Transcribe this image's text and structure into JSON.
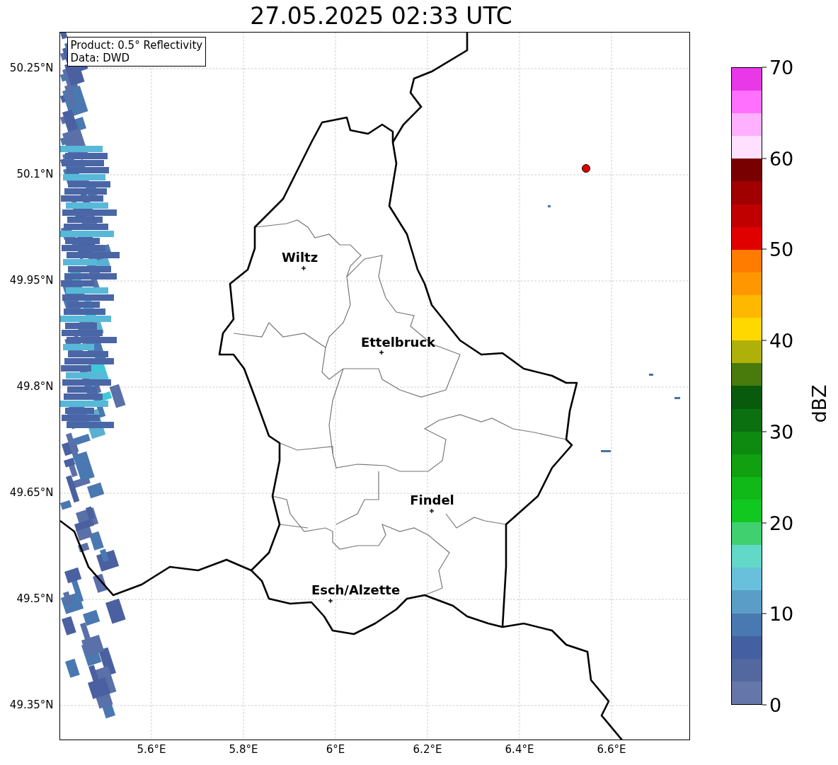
{
  "title": "27.05.2025 02:33 UTC",
  "info_box": [
    "Product: 0.5° Reflectivity",
    "Data: DWD"
  ],
  "y_ticks": [
    "50.25°N",
    "50.1°N",
    "49.95°N",
    "49.8°N",
    "49.65°N",
    "49.5°N",
    "49.35°N"
  ],
  "x_ticks": [
    "5.6°E",
    "5.8°E",
    "6°E",
    "6.2°E",
    "6.4°E",
    "6.6°E"
  ],
  "cities": [
    {
      "name": "Wiltz"
    },
    {
      "name": "Ettelbruck"
    },
    {
      "name": "Findel"
    },
    {
      "name": "Esch/Alzette"
    }
  ],
  "colorbar": {
    "label": "dBZ",
    "ticks": [
      "70",
      "60",
      "50",
      "40",
      "30",
      "20",
      "10",
      "0"
    ],
    "bins": [
      {
        "color": "#6577a8"
      },
      {
        "color": "#5468a0"
      },
      {
        "color": "#4560a0"
      },
      {
        "color": "#4a78b0"
      },
      {
        "color": "#5a9ec8"
      },
      {
        "color": "#68c0dc"
      },
      {
        "color": "#62d8c8"
      },
      {
        "color": "#40d070"
      },
      {
        "color": "#10c820"
      },
      {
        "color": "#10b818"
      },
      {
        "color": "#10a010"
      },
      {
        "color": "#0e8a10"
      },
      {
        "color": "#0a7010"
      },
      {
        "color": "#085a0c"
      },
      {
        "color": "#487a0c"
      },
      {
        "color": "#b0b00a"
      },
      {
        "color": "#ffd800"
      },
      {
        "color": "#ffb800"
      },
      {
        "color": "#ff9800"
      },
      {
        "color": "#ff7c00"
      },
      {
        "color": "#e00000"
      },
      {
        "color": "#c00000"
      },
      {
        "color": "#a00000"
      },
      {
        "color": "#780000"
      },
      {
        "color": "#ffe0ff"
      },
      {
        "color": "#ffb0ff"
      },
      {
        "color": "#ff70ff"
      },
      {
        "color": "#e838e8"
      }
    ]
  }
}
